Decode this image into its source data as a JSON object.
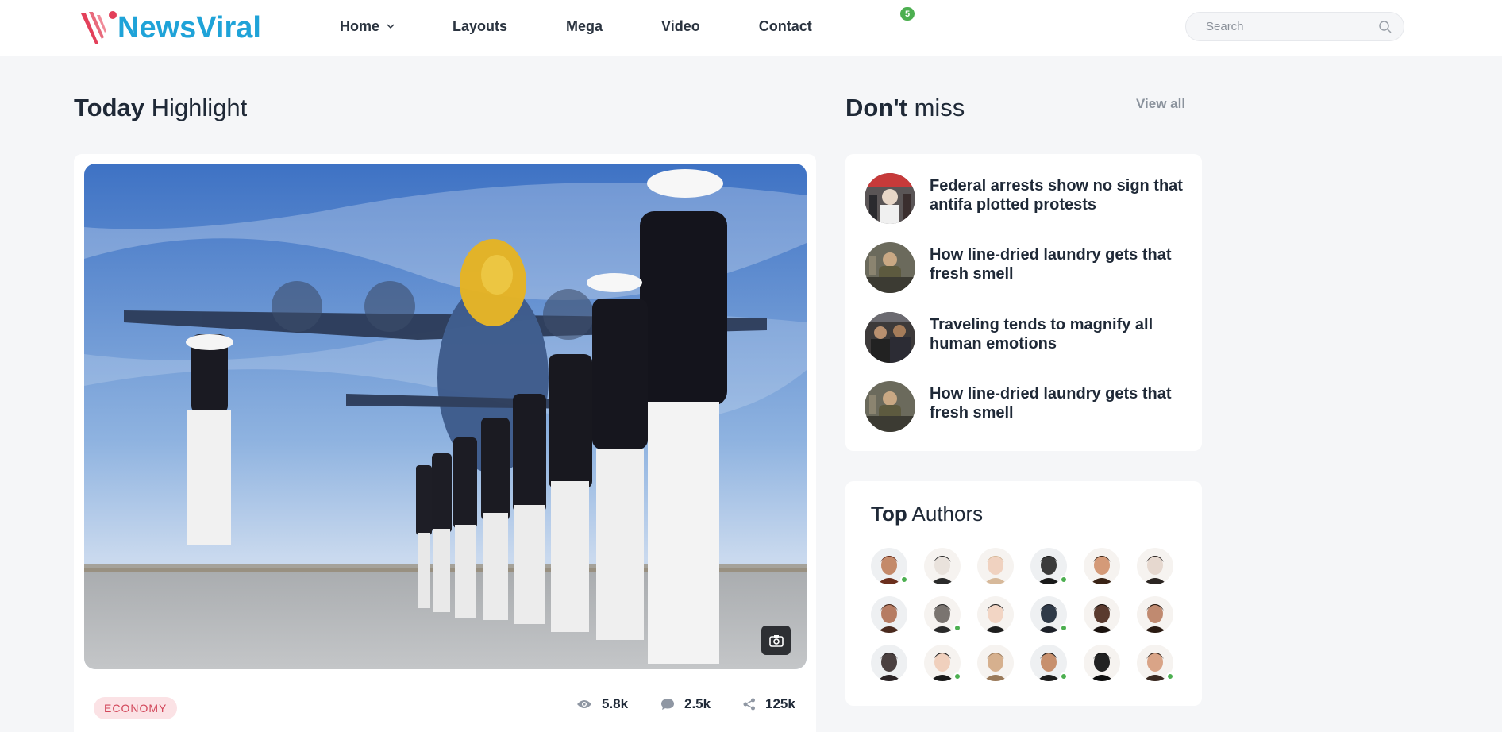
{
  "header": {
    "brand": "NewsViral",
    "nav": [
      {
        "label": "Home",
        "has_dropdown": true
      },
      {
        "label": "Layouts"
      },
      {
        "label": "Mega"
      },
      {
        "label": "Video"
      },
      {
        "label": "Contact"
      }
    ],
    "notification_count": "5",
    "search_placeholder": "Search"
  },
  "highlight": {
    "title_bold": "Today",
    "title_rest": "Highlight",
    "category": "ECONOMY",
    "stats": {
      "views": "5.8k",
      "comments": "2.5k",
      "shares": "125k"
    }
  },
  "dont_miss": {
    "title_bold": "Don't",
    "title_rest": "miss",
    "view_all": "View all",
    "items": [
      {
        "title": "Federal arrests show no sign that antifa plotted protests"
      },
      {
        "title": "How line-dried laundry gets that fresh smell"
      },
      {
        "title": "Traveling tends to magnify all human emotions"
      },
      {
        "title": "How line-dried laundry gets that fresh smell"
      }
    ]
  },
  "top_authors": {
    "title_bold": "Top",
    "title_rest": "Authors",
    "avatars": [
      {
        "online": true
      },
      {
        "online": false
      },
      {
        "online": false
      },
      {
        "online": true
      },
      {
        "online": false
      },
      {
        "online": false
      },
      {
        "online": false
      },
      {
        "online": true
      },
      {
        "online": false
      },
      {
        "online": true
      },
      {
        "online": false
      },
      {
        "online": false
      },
      {
        "online": false
      },
      {
        "online": true
      },
      {
        "online": false
      },
      {
        "online": true
      },
      {
        "online": false
      },
      {
        "online": true
      }
    ]
  },
  "colors": {
    "brand_blue": "#1fa3d8",
    "brand_red": "#e3405a",
    "online_green": "#4caf50",
    "tag_bg": "#fbe2e5",
    "tag_text": "#d2475a"
  }
}
